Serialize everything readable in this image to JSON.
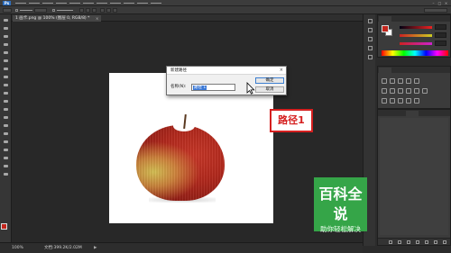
{
  "menubar": {
    "logo": "Ps"
  },
  "document": {
    "tab_title": "1 画卡.png @ 100% (图层 0, RGB/8) *",
    "close_label": "×"
  },
  "dialog": {
    "title": "新建路径",
    "close_label": "×",
    "name_label": "名称(N):",
    "name_value": "路径 1",
    "ok_label": "确定",
    "cancel_label": "取消"
  },
  "annotation": {
    "path_label": "路径1"
  },
  "watermark": {
    "title": "百科全说",
    "subtitle": "助你轻松解决"
  },
  "status": {
    "zoom": "100%",
    "doc_info": "文档:399.2K/2.02M",
    "arrow": "▶"
  },
  "colors": {
    "foreground": "#c3261d",
    "background": "#ffffff",
    "watermark": "#35a548",
    "accent_red": "#d52020"
  },
  "icons": [
    "search-icon",
    "move-tool-icon",
    "marquee-tool-icon",
    "lasso-tool-icon",
    "brush-tool-icon",
    "pen-tool-icon",
    "text-tool-icon",
    "hand-tool-icon",
    "zoom-tool-icon",
    "pointer-cursor-icon"
  ]
}
